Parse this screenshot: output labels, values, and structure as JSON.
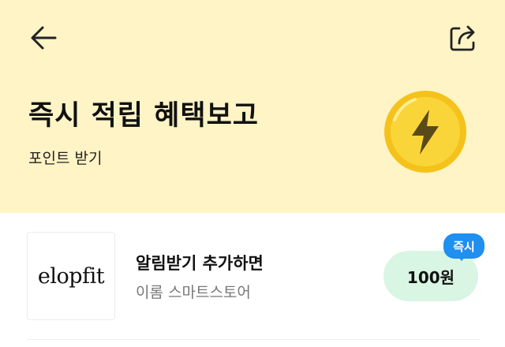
{
  "header": {
    "back_icon": "arrow-left-icon",
    "share_icon": "share-icon"
  },
  "hero": {
    "title": "즉시 적립 혜택보고",
    "subtitle": "포인트 받기",
    "coin_icon": "lightning-coin-icon",
    "background": "#fff4c6"
  },
  "item": {
    "logo_text": "elopfit",
    "title": "알림받기 추가하면",
    "store_name": "이롬 스마트스토어",
    "reward": "100원",
    "badge": "즉시",
    "reward_bg": "#d9f5e3",
    "badge_color": "#1f8ff0"
  }
}
